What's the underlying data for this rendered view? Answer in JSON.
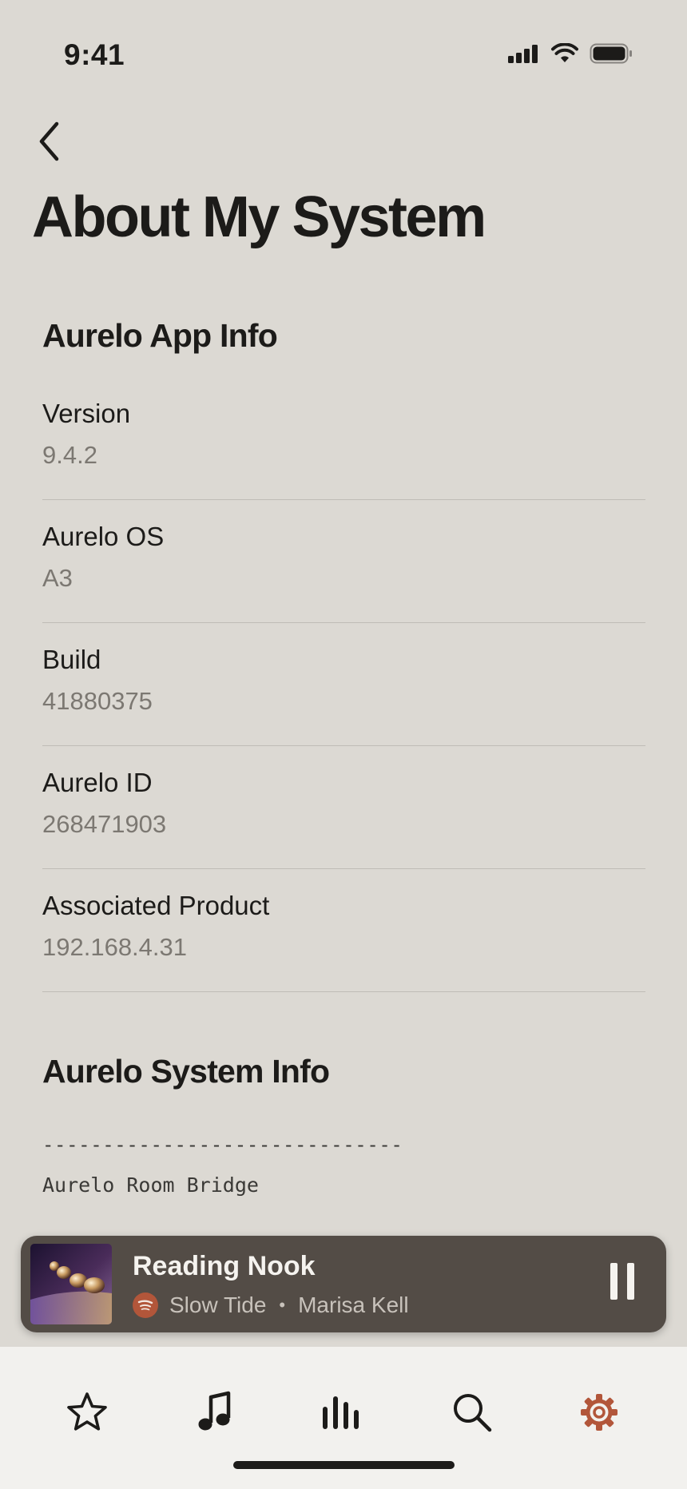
{
  "status_bar": {
    "time": "9:41",
    "icons": [
      "cellular-signal-icon",
      "wifi-icon",
      "battery-icon"
    ]
  },
  "navigation": {
    "back_icon": "chevron-left-icon"
  },
  "page": {
    "title": "About My System"
  },
  "app_info": {
    "heading": "Aurelo App Info",
    "rows": [
      {
        "label": "Version",
        "value": "9.4.2"
      },
      {
        "label": "Aurelo OS",
        "value": "A3"
      },
      {
        "label": "Build",
        "value": "41880375"
      },
      {
        "label": "Aurelo ID",
        "value": "268471903"
      },
      {
        "label": "Associated Product",
        "value": "192.168.4.31"
      }
    ]
  },
  "system_info": {
    "heading": "Aurelo System Info",
    "divider": "------------------------------",
    "first_line": "Aurelo Room Bridge"
  },
  "now_playing": {
    "room": "Reading Nook",
    "track": "Slow Tide",
    "separator": "•",
    "artist": "Marisa Kell",
    "service_icon": "spotify-icon",
    "control_icon": "pause-icon",
    "colors": {
      "bar_background": "#534c46",
      "service_badge": "#b2563a"
    }
  },
  "tab_bar": {
    "tabs": [
      {
        "icon": "star-icon",
        "selected": false
      },
      {
        "icon": "music-note-icon",
        "selected": false
      },
      {
        "icon": "rooms-bars-icon",
        "selected": false
      },
      {
        "icon": "search-icon",
        "selected": false
      },
      {
        "icon": "gear-icon",
        "selected": true
      }
    ],
    "colors": {
      "active": "#b2563a",
      "inactive": "#1c1b19"
    }
  }
}
